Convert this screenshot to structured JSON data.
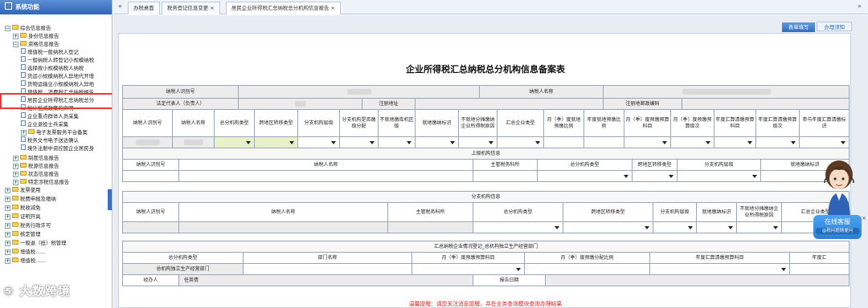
{
  "sidebar": {
    "title": "系统功能",
    "items": [
      {
        "label": "综合信息报告",
        "level": 0,
        "type": "folder",
        "toggle": "−"
      },
      {
        "label": "身份信息报告",
        "level": 1,
        "type": "folder",
        "toggle": "+"
      },
      {
        "label": "资格信息报告",
        "level": 1,
        "type": "folder",
        "toggle": "−"
      },
      {
        "label": "增值税一般纳税人登记",
        "level": 2,
        "type": "page"
      },
      {
        "label": "一般纳税人转登记小规模纳税",
        "level": 2,
        "type": "page"
      },
      {
        "label": "选择按小规模纳税人纳税",
        "level": 2,
        "type": "page"
      },
      {
        "label": "货运小规模纳税人异地代开增",
        "level": 2,
        "type": "page"
      },
      {
        "label": "货物运输业小规模纳税人异地",
        "level": 2,
        "type": "page"
      },
      {
        "label": "增值税、消费税汇总纳税报告",
        "level": 2,
        "type": "page"
      },
      {
        "label": "居民企业所得税汇总纳税总分",
        "level": 2,
        "type": "page"
      },
      {
        "label": "加计抵减政策的声明",
        "level": 2,
        "type": "page"
      },
      {
        "label": "企业重点群体人员采集",
        "level": 2,
        "type": "page"
      },
      {
        "label": "企业退役士兵采集",
        "level": 2,
        "type": "page"
      },
      {
        "label": "电子发票服务平台备案",
        "level": 2,
        "type": "folder",
        "toggle": "+"
      },
      {
        "label": "税务文书电子送达确认",
        "level": 2,
        "type": "page"
      },
      {
        "label": "境外注册中资控股企业居民身",
        "level": 2,
        "type": "page"
      },
      {
        "label": "制度信息报告",
        "level": 1,
        "type": "folder",
        "toggle": "+"
      },
      {
        "label": "税源信息报告",
        "level": 1,
        "type": "folder",
        "toggle": "+"
      },
      {
        "label": "状态信息报告",
        "level": 1,
        "type": "folder",
        "toggle": "+"
      },
      {
        "label": "特定涉税信息报告",
        "level": 1,
        "type": "folder",
        "toggle": "+"
      },
      {
        "label": "发票使用",
        "level": 0,
        "type": "folder",
        "toggle": "+"
      },
      {
        "label": "税费申报及缴纳",
        "level": 0,
        "type": "folder",
        "toggle": "+"
      },
      {
        "label": "税收减免",
        "level": 0,
        "type": "folder",
        "toggle": "+"
      },
      {
        "label": "证明开具",
        "level": 0,
        "type": "folder",
        "toggle": "+"
      },
      {
        "label": "税务行政许可",
        "level": 0,
        "type": "folder",
        "toggle": "+"
      },
      {
        "label": "核定管理",
        "level": 0,
        "type": "folder",
        "toggle": "+"
      },
      {
        "label": "一般退（抵）税管理",
        "level": 0,
        "type": "folder",
        "toggle": "+"
      },
      {
        "label": "增值税……",
        "level": 0,
        "type": "folder",
        "toggle": "+"
      },
      {
        "label": "增值税……",
        "level": 0,
        "type": "folder",
        "toggle": "+"
      }
    ]
  },
  "tabs": {
    "nav_back": "«",
    "nav_forward": "»",
    "items": [
      {
        "label": "办税桌面"
      },
      {
        "label": "税务登记信息变更",
        "close": "×"
      },
      {
        "label": "居民企业所得税汇总纳税总分机构信息报告",
        "close": "×"
      }
    ]
  },
  "toolbar": {
    "fill_label": "表单填写",
    "guide_label": "办理须知"
  },
  "form": {
    "title": "企业所得税汇总纳税总分机构信息备案表",
    "r1": {
      "taxpayer_id": "纳税人识别号",
      "taxpayer_name": "纳税人名称"
    },
    "r2": {
      "legal_rep": "法定代表人（负责人）",
      "reg_address": "注册地址",
      "reg_postcode": "注册地邮政编码"
    },
    "head": [
      "纳税人识别号",
      "纳税人名称",
      "总分机构类型",
      "跨地区转移类型",
      "分支机构层级",
      "分支机构是否缴级分配",
      "不就地缴库机区级",
      "就地缴纳标识",
      "不就地分摊缴纳企业所得税原因",
      "汇总企业类型",
      "月（季）度就地预缴比例",
      "年度就地预缴比例",
      "月（季）度预缴预算科目",
      "月（季）度预缴预算级次",
      "年度汇算清缴预算科目",
      "年度汇算清缴预算级次",
      "参与年度汇算清缴标识"
    ],
    "upper": {
      "section": "上级机构信息",
      "head": [
        "纳税人识别号",
        "纳税人名称",
        "主管税务科所",
        "总分机构类型",
        "跨地区转移类型",
        "分支机构层级",
        "就地缴纳标识"
      ]
    },
    "branch": {
      "section": "分支机构信息",
      "head": [
        "纳税人识别号",
        "纳税人名称",
        "主管税务科所",
        "总分机构类型",
        "跨地区转移类型",
        "分支机构层级",
        "就地缴纳标识",
        "不就地分摊缴纳企业所得税原因",
        "汇总企业类型"
      ]
    },
    "summary": {
      "section": "汇总纳税企业情况登记_总机构独立生产经营部门",
      "head": [
        "总分机构类型",
        "部门名称",
        "月（季）度预缴预算科目",
        "月（季）度预缴分配比例",
        "年度汇算清缴预算科目",
        "年度汇"
      ],
      "row_label": "总机构独立生产经营部门"
    },
    "footer": {
      "handler_label": "经办人",
      "handler_value": "任英倩",
      "report_date_label": "报告日期"
    },
    "warning": "温馨提醒：请您关注消息提醒，并在业务查询模块查询办理结果"
  },
  "service": {
    "title": "在线客服",
    "subtitle": "@税问题随便问",
    "close": "×"
  },
  "watermark": "⑤ 大数跨境"
}
